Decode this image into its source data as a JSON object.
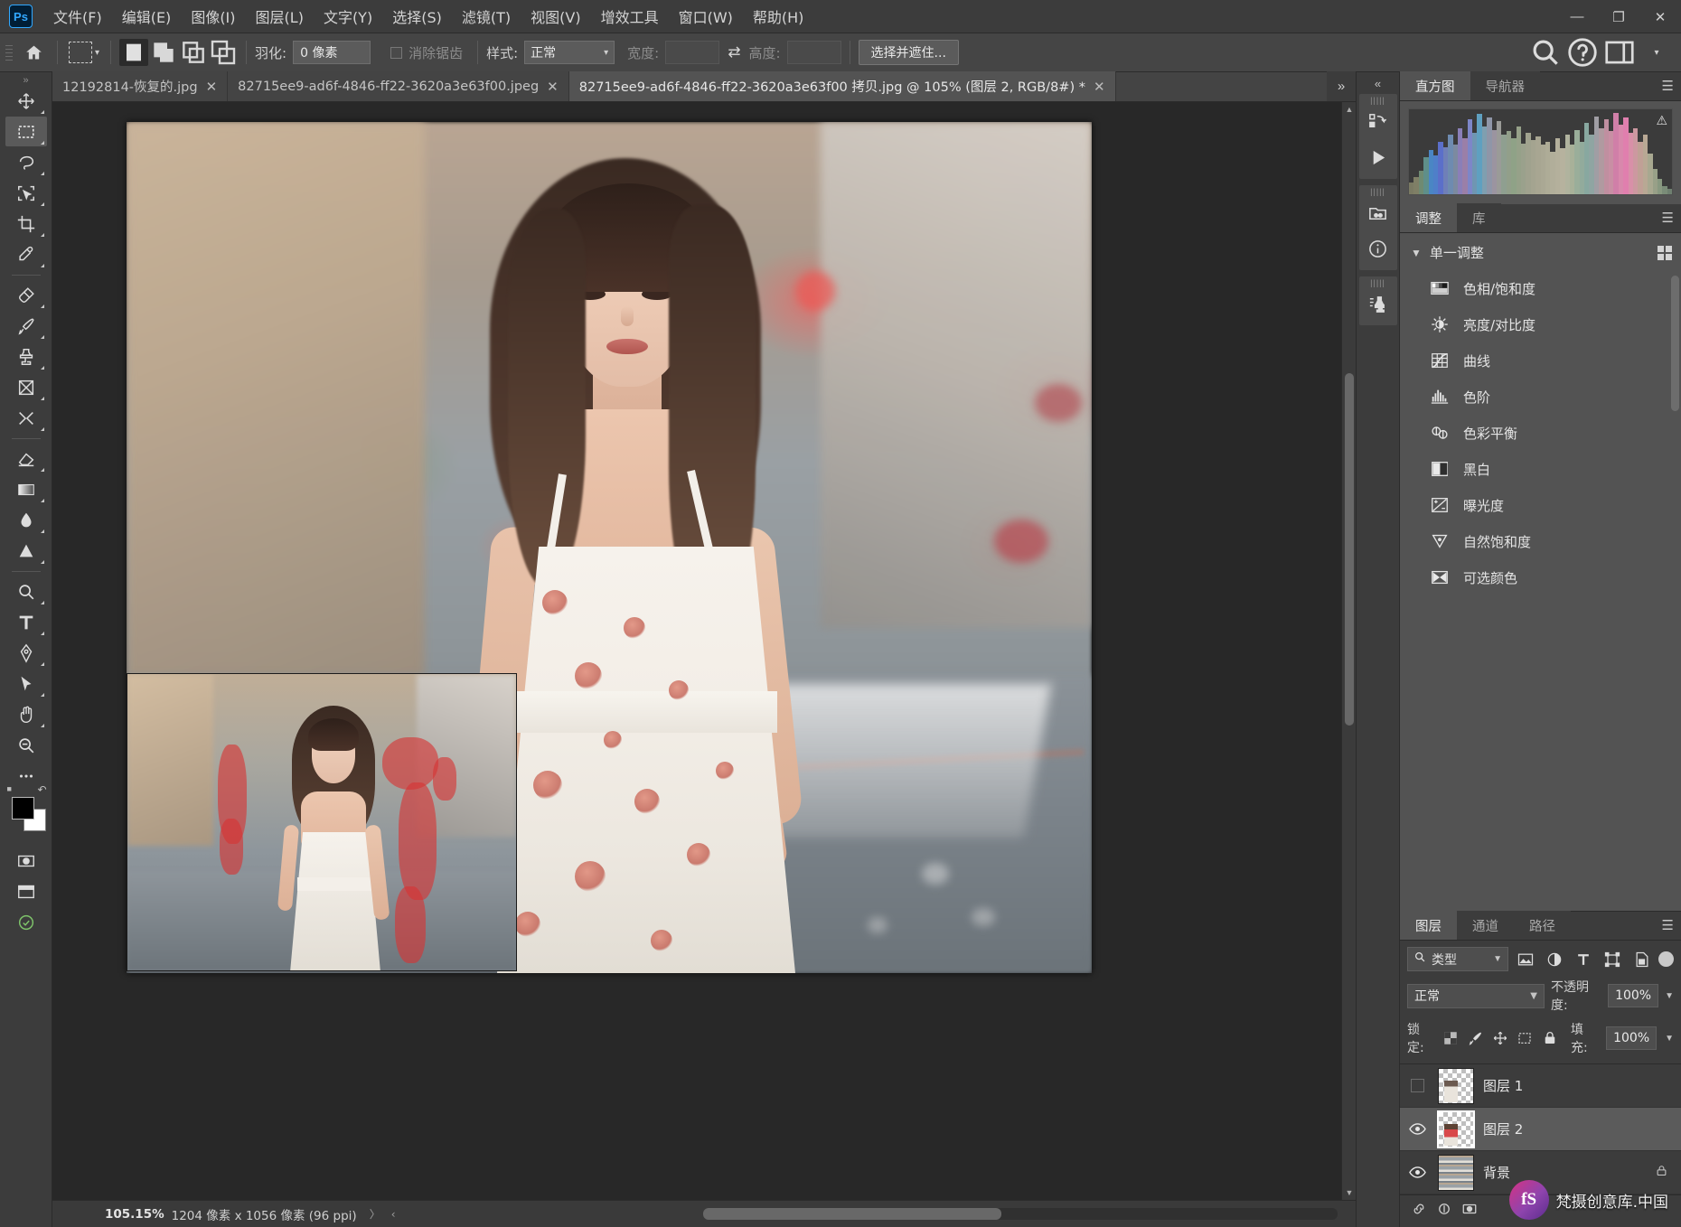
{
  "app": {
    "name": "Adobe Photoshop",
    "logo_text": "Ps"
  },
  "menubar": {
    "items": [
      {
        "label": "文件(F)",
        "name": "menu-file"
      },
      {
        "label": "编辑(E)",
        "name": "menu-edit"
      },
      {
        "label": "图像(I)",
        "name": "menu-image"
      },
      {
        "label": "图层(L)",
        "name": "menu-layer"
      },
      {
        "label": "文字(Y)",
        "name": "menu-type"
      },
      {
        "label": "选择(S)",
        "name": "menu-select"
      },
      {
        "label": "滤镜(T)",
        "name": "menu-filter"
      },
      {
        "label": "视图(V)",
        "name": "menu-view"
      },
      {
        "label": "增效工具",
        "name": "menu-plugins"
      },
      {
        "label": "窗口(W)",
        "name": "menu-window"
      },
      {
        "label": "帮助(H)",
        "name": "menu-help"
      }
    ],
    "window_controls": {
      "minimize": "—",
      "maximize": "❐",
      "close": "✕"
    }
  },
  "options_bar": {
    "home_icon": "home-icon",
    "tool_preset": "marquee-tool",
    "selection_modes": [
      "new-selection",
      "add-to-selection",
      "subtract-from-selection",
      "intersect-selection"
    ],
    "active_selection_mode": 0,
    "feather_label": "羽化:",
    "feather_value": "0 像素",
    "antialias_label": "消除锯齿",
    "antialias_checked": false,
    "style_label": "样式:",
    "style_value": "正常",
    "width_label": "宽度:",
    "width_value": "",
    "height_label": "高度:",
    "height_value": "",
    "swap_icon": "swap-arrows-icon",
    "select_and_mask": "选择并遮住...",
    "right_icons": [
      "search-icon",
      "help-icon",
      "workspace-icon",
      "chevron-down-icon"
    ]
  },
  "document_tabs": {
    "tabs": [
      {
        "title": "12192814-恢复的.jpg",
        "active": false,
        "name": "doc-tab-1"
      },
      {
        "title": "82715ee9-ad6f-4846-ff22-3620a3e63f00.jpeg",
        "active": false,
        "name": "doc-tab-2"
      },
      {
        "title": "82715ee9-ad6f-4846-ff22-3620a3e63f00 拷贝.jpg @ 105% (图层 2, RGB/8#) *",
        "active": true,
        "name": "doc-tab-3"
      }
    ],
    "overflow_icon": "»",
    "close_icon": "✕"
  },
  "toolbar": {
    "tools": [
      {
        "name": "move-tool",
        "icon": "move"
      },
      {
        "name": "rectangular-marquee-tool",
        "icon": "marquee",
        "active": true
      },
      {
        "name": "lasso-tool",
        "icon": "lasso"
      },
      {
        "name": "object-selection-tool",
        "icon": "quickselect"
      },
      {
        "name": "crop-tool",
        "icon": "crop"
      },
      {
        "name": "eyedropper-tool",
        "icon": "eyedropper"
      },
      {
        "name": "spot-healing-brush-tool",
        "icon": "healing"
      },
      {
        "name": "brush-tool",
        "icon": "brush"
      },
      {
        "name": "clone-stamp-tool",
        "icon": "stamp"
      },
      {
        "name": "frame-tool",
        "icon": "frame"
      },
      {
        "name": "history-brush-tool",
        "icon": "historybrush"
      },
      {
        "name": "eraser-tool",
        "icon": "eraser"
      },
      {
        "name": "gradient-tool",
        "icon": "gradient"
      },
      {
        "name": "blur-tool",
        "icon": "blur"
      },
      {
        "name": "dodge-tool",
        "icon": "dodge"
      },
      {
        "name": "pen-tool",
        "icon": "pen"
      },
      {
        "name": "horizontal-type-tool",
        "icon": "type"
      },
      {
        "name": "path-selection-tool",
        "icon": "pathselect"
      },
      {
        "name": "rectangle-tool",
        "icon": "shape"
      },
      {
        "name": "hand-tool",
        "icon": "hand"
      },
      {
        "name": "zoom-tool",
        "icon": "zoom"
      },
      {
        "name": "more-tools",
        "icon": "ellipsis"
      }
    ],
    "foreground_color": "#000000",
    "background_color": "#ffffff",
    "edit_toolbar_icon": "edit-toolbar-icon",
    "quick-mask-icon": "quick-mask-icon",
    "screen-mode-icon": "screen-mode-icon"
  },
  "histogram_panel": {
    "tabs": [
      {
        "label": "直方图",
        "active": true,
        "name": "panel-tab-histogram"
      },
      {
        "label": "导航器",
        "active": false,
        "name": "panel-tab-navigator"
      }
    ],
    "warning_icon": "warning-icon",
    "menu_icon": "panel-menu-icon"
  },
  "adjustments_panel": {
    "tabs": [
      {
        "label": "调整",
        "active": true,
        "name": "panel-tab-adjustments"
      },
      {
        "label": "库",
        "active": false,
        "name": "panel-tab-libraries"
      }
    ],
    "section_title": "单一调整",
    "grid_icon": "grid-view-icon",
    "items": [
      {
        "label": "色相/饱和度",
        "icon": "hue-saturation-icon",
        "name": "adjustment-hue-saturation"
      },
      {
        "label": "亮度/对比度",
        "icon": "brightness-contrast-icon",
        "name": "adjustment-brightness-contrast"
      },
      {
        "label": "曲线",
        "icon": "curves-icon",
        "name": "adjustment-curves"
      },
      {
        "label": "色阶",
        "icon": "levels-icon",
        "name": "adjustment-levels"
      },
      {
        "label": "色彩平衡",
        "icon": "color-balance-icon",
        "name": "adjustment-color-balance"
      },
      {
        "label": "黑白",
        "icon": "black-white-icon",
        "name": "adjustment-black-white"
      },
      {
        "label": "曝光度",
        "icon": "exposure-icon",
        "name": "adjustment-exposure"
      },
      {
        "label": "自然饱和度",
        "icon": "vibrance-icon",
        "name": "adjustment-vibrance"
      },
      {
        "label": "可选颜色",
        "icon": "selective-color-icon",
        "name": "adjustment-selective-color"
      }
    ]
  },
  "layers_panel": {
    "tabs": [
      {
        "label": "图层",
        "active": true,
        "name": "panel-tab-layers"
      },
      {
        "label": "通道",
        "active": false,
        "name": "panel-tab-channels"
      },
      {
        "label": "路径",
        "active": false,
        "name": "panel-tab-paths"
      }
    ],
    "filter_label": "类型",
    "filter_icons": [
      "filter-image-icon",
      "filter-adjustment-icon",
      "filter-type-icon",
      "filter-shape-icon",
      "filter-smart-object-icon"
    ],
    "blend_mode": "正常",
    "opacity_label": "不透明度:",
    "opacity_value": "100%",
    "lock_label": "锁定:",
    "lock_icons": [
      "lock-transparency-icon",
      "lock-image-icon",
      "lock-position-icon",
      "lock-artboard-icon",
      "lock-all-icon"
    ],
    "fill_label": "填充:",
    "fill_value": "100%",
    "layers": [
      {
        "name": "图层 1",
        "visible": false,
        "selected": false,
        "locked": false,
        "transparent": true
      },
      {
        "name": "图层 2",
        "visible": true,
        "selected": true,
        "locked": false,
        "transparent": true
      },
      {
        "name": "背景",
        "visible": true,
        "selected": false,
        "locked": true,
        "transparent": false
      }
    ],
    "bottom_icons": [
      "link-layers-icon",
      "layer-style-icon",
      "layer-mask-icon"
    ]
  },
  "icon_dock": {
    "collapse_icon": "«",
    "buttons": [
      {
        "name": "history-icon"
      },
      {
        "name": "actions-play-icon"
      },
      {
        "name": "libraries-icon"
      },
      {
        "name": "info-icon"
      },
      {
        "name": "properties-clone-icon"
      }
    ]
  },
  "status_bar": {
    "zoom": "105.15%",
    "dimensions": "1204 像素 x 1056 像素 (96 ppi)",
    "arrow_right": "〉",
    "arrow_left": "‹"
  },
  "watermark": {
    "badge": "fS",
    "text": "梵摄创意库.中国"
  },
  "colors": {
    "accent": "#31a8ff",
    "panel_bg": "#535353",
    "window_bg": "#3c3c3c",
    "canvas_bg": "#282828",
    "selection_red": "#d63434"
  }
}
